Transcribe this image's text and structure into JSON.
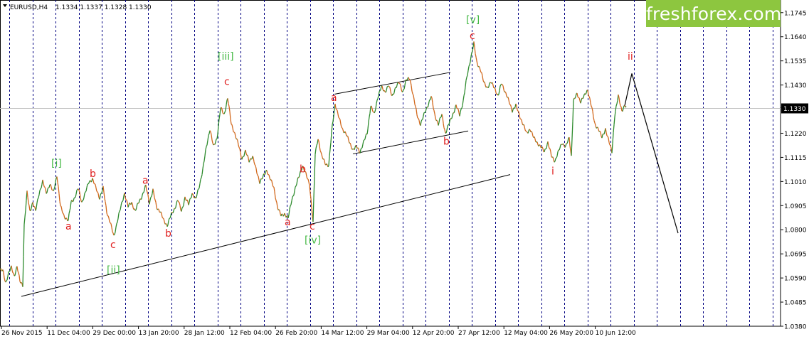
{
  "chart_header": {
    "symbol_label": "EURUSD,H4",
    "ohlc_text": "1.1334 1.1337 1.1328 1.1330",
    "menu_icon": "triangle-down-icon"
  },
  "brand": {
    "logo_text": "freshforex.com",
    "color": "#8dc63f"
  },
  "current_price_label": "1.1330",
  "colors": {
    "bull": "#2e8b2e",
    "bear": "#d2691e",
    "grid": "#000080",
    "wave_red": "#e02020",
    "wave_green": "#46b946",
    "trendline": "#000000"
  },
  "chart_data": {
    "type": "line",
    "y_ticks": [
      "1.1745",
      "1.1640",
      "1.1535",
      "1.1430",
      "1.1330",
      "1.1220",
      "1.1115",
      "1.1010",
      "1.0905",
      "1.0800",
      "1.0695",
      "1.0590",
      "1.0485",
      "1.0380"
    ],
    "x_ticks": [
      "26 Nov 2015",
      "11 Dec 04:00",
      "29 Dec 00:00",
      "13 Jan 20:00",
      "28 Jan 12:00",
      "12 Feb 04:00",
      "26 Feb 20:00",
      "14 Mar 12:00",
      "29 Mar 04:00",
      "12 Apr 20:00",
      "27 Apr 12:00",
      "12 May 04:00",
      "26 May 20:00",
      "10 Jun 12:00"
    ],
    "ylim": [
      1.038,
      1.18
    ],
    "current_price": 1.133,
    "grid": true,
    "price_path": [
      {
        "x": 0,
        "y": 1.0625
      },
      {
        "x": 4,
        "y": 1.062
      },
      {
        "x": 8,
        "y": 1.057
      },
      {
        "x": 12,
        "y": 1.061
      },
      {
        "x": 16,
        "y": 1.0635
      },
      {
        "x": 20,
        "y": 1.06
      },
      {
        "x": 24,
        "y": 1.064
      },
      {
        "x": 28,
        "y": 1.0575
      },
      {
        "x": 32,
        "y": 1.056
      },
      {
        "x": 34,
        "y": 1.082
      },
      {
        "x": 38,
        "y": 1.096
      },
      {
        "x": 42,
        "y": 1.088
      },
      {
        "x": 46,
        "y": 1.092
      },
      {
        "x": 50,
        "y": 1.088
      },
      {
        "x": 55,
        "y": 1.096
      },
      {
        "x": 60,
        "y": 1.101
      },
      {
        "x": 65,
        "y": 1.096
      },
      {
        "x": 70,
        "y": 1.1
      },
      {
        "x": 75,
        "y": 1.096
      },
      {
        "x": 80,
        "y": 1.104
      },
      {
        "x": 85,
        "y": 1.09
      },
      {
        "x": 90,
        "y": 1.086
      },
      {
        "x": 96,
        "y": 1.084
      },
      {
        "x": 100,
        "y": 1.092
      },
      {
        "x": 105,
        "y": 1.094
      },
      {
        "x": 110,
        "y": 1.098
      },
      {
        "x": 115,
        "y": 1.092
      },
      {
        "x": 120,
        "y": 1.096
      },
      {
        "x": 125,
        "y": 1.101
      },
      {
        "x": 130,
        "y": 1.102
      },
      {
        "x": 135,
        "y": 1.098
      },
      {
        "x": 140,
        "y": 1.094
      },
      {
        "x": 145,
        "y": 1.098
      },
      {
        "x": 150,
        "y": 1.088
      },
      {
        "x": 155,
        "y": 1.083
      },
      {
        "x": 160,
        "y": 1.077
      },
      {
        "x": 165,
        "y": 1.084
      },
      {
        "x": 170,
        "y": 1.09
      },
      {
        "x": 175,
        "y": 1.096
      },
      {
        "x": 180,
        "y": 1.09
      },
      {
        "x": 185,
        "y": 1.092
      },
      {
        "x": 190,
        "y": 1.088
      },
      {
        "x": 195,
        "y": 1.092
      },
      {
        "x": 200,
        "y": 1.095
      },
      {
        "x": 205,
        "y": 1.099
      },
      {
        "x": 210,
        "y": 1.092
      },
      {
        "x": 215,
        "y": 1.097
      },
      {
        "x": 220,
        "y": 1.09
      },
      {
        "x": 225,
        "y": 1.088
      },
      {
        "x": 230,
        "y": 1.084
      },
      {
        "x": 235,
        "y": 1.082
      },
      {
        "x": 240,
        "y": 1.086
      },
      {
        "x": 245,
        "y": 1.089
      },
      {
        "x": 250,
        "y": 1.093
      },
      {
        "x": 255,
        "y": 1.088
      },
      {
        "x": 260,
        "y": 1.094
      },
      {
        "x": 265,
        "y": 1.091
      },
      {
        "x": 270,
        "y": 1.096
      },
      {
        "x": 275,
        "y": 1.093
      },
      {
        "x": 280,
        "y": 1.099
      },
      {
        "x": 285,
        "y": 1.106
      },
      {
        "x": 290,
        "y": 1.116
      },
      {
        "x": 295,
        "y": 1.124
      },
      {
        "x": 300,
        "y": 1.116
      },
      {
        "x": 305,
        "y": 1.12
      },
      {
        "x": 310,
        "y": 1.133
      },
      {
        "x": 315,
        "y": 1.13
      },
      {
        "x": 320,
        "y": 1.1375
      },
      {
        "x": 325,
        "y": 1.126
      },
      {
        "x": 330,
        "y": 1.122
      },
      {
        "x": 335,
        "y": 1.117
      },
      {
        "x": 340,
        "y": 1.111
      },
      {
        "x": 345,
        "y": 1.114
      },
      {
        "x": 350,
        "y": 1.11
      },
      {
        "x": 355,
        "y": 1.112
      },
      {
        "x": 360,
        "y": 1.106
      },
      {
        "x": 365,
        "y": 1.101
      },
      {
        "x": 370,
        "y": 1.103
      },
      {
        "x": 375,
        "y": 1.106
      },
      {
        "x": 380,
        "y": 1.102
      },
      {
        "x": 385,
        "y": 1.098
      },
      {
        "x": 390,
        "y": 1.09
      },
      {
        "x": 395,
        "y": 1.086
      },
      {
        "x": 400,
        "y": 1.087
      },
      {
        "x": 405,
        "y": 1.085
      },
      {
        "x": 410,
        "y": 1.093
      },
      {
        "x": 415,
        "y": 1.098
      },
      {
        "x": 420,
        "y": 1.103
      },
      {
        "x": 425,
        "y": 1.108
      },
      {
        "x": 430,
        "y": 1.104
      },
      {
        "x": 435,
        "y": 1.1
      },
      {
        "x": 440,
        "y": 1.083
      },
      {
        "x": 443,
        "y": 1.113
      },
      {
        "x": 447,
        "y": 1.12
      },
      {
        "x": 452,
        "y": 1.112
      },
      {
        "x": 457,
        "y": 1.109
      },
      {
        "x": 462,
        "y": 1.108
      },
      {
        "x": 467,
        "y": 1.125
      },
      {
        "x": 471,
        "y": 1.135
      },
      {
        "x": 476,
        "y": 1.129
      },
      {
        "x": 481,
        "y": 1.124
      },
      {
        "x": 486,
        "y": 1.122
      },
      {
        "x": 491,
        "y": 1.118
      },
      {
        "x": 496,
        "y": 1.115
      },
      {
        "x": 501,
        "y": 1.116
      },
      {
        "x": 506,
        "y": 1.114
      },
      {
        "x": 511,
        "y": 1.118
      },
      {
        "x": 516,
        "y": 1.122
      },
      {
        "x": 521,
        "y": 1.134
      },
      {
        "x": 526,
        "y": 1.13
      },
      {
        "x": 531,
        "y": 1.138
      },
      {
        "x": 536,
        "y": 1.142
      },
      {
        "x": 541,
        "y": 1.14
      },
      {
        "x": 546,
        "y": 1.143
      },
      {
        "x": 551,
        "y": 1.138
      },
      {
        "x": 556,
        "y": 1.142
      },
      {
        "x": 561,
        "y": 1.144
      },
      {
        "x": 566,
        "y": 1.14
      },
      {
        "x": 571,
        "y": 1.145
      },
      {
        "x": 576,
        "y": 1.146
      },
      {
        "x": 581,
        "y": 1.138
      },
      {
        "x": 586,
        "y": 1.13
      },
      {
        "x": 591,
        "y": 1.126
      },
      {
        "x": 596,
        "y": 1.13
      },
      {
        "x": 601,
        "y": 1.134
      },
      {
        "x": 606,
        "y": 1.138
      },
      {
        "x": 611,
        "y": 1.13
      },
      {
        "x": 616,
        "y": 1.126
      },
      {
        "x": 621,
        "y": 1.13
      },
      {
        "x": 626,
        "y": 1.122
      },
      {
        "x": 631,
        "y": 1.126
      },
      {
        "x": 636,
        "y": 1.13
      },
      {
        "x": 641,
        "y": 1.134
      },
      {
        "x": 646,
        "y": 1.13
      },
      {
        "x": 651,
        "y": 1.136
      },
      {
        "x": 656,
        "y": 1.146
      },
      {
        "x": 661,
        "y": 1.154
      },
      {
        "x": 666,
        "y": 1.161
      },
      {
        "x": 670,
        "y": 1.153
      },
      {
        "x": 675,
        "y": 1.15
      },
      {
        "x": 680,
        "y": 1.144
      },
      {
        "x": 685,
        "y": 1.142
      },
      {
        "x": 690,
        "y": 1.144
      },
      {
        "x": 695,
        "y": 1.142
      },
      {
        "x": 700,
        "y": 1.138
      },
      {
        "x": 705,
        "y": 1.144
      },
      {
        "x": 710,
        "y": 1.14
      },
      {
        "x": 715,
        "y": 1.136
      },
      {
        "x": 720,
        "y": 1.132
      },
      {
        "x": 725,
        "y": 1.134
      },
      {
        "x": 730,
        "y": 1.13
      },
      {
        "x": 735,
        "y": 1.126
      },
      {
        "x": 740,
        "y": 1.122
      },
      {
        "x": 745,
        "y": 1.124
      },
      {
        "x": 750,
        "y": 1.12
      },
      {
        "x": 755,
        "y": 1.118
      },
      {
        "x": 760,
        "y": 1.116
      },
      {
        "x": 765,
        "y": 1.114
      },
      {
        "x": 770,
        "y": 1.118
      },
      {
        "x": 775,
        "y": 1.112
      },
      {
        "x": 780,
        "y": 1.11
      },
      {
        "x": 785,
        "y": 1.114
      },
      {
        "x": 790,
        "y": 1.118
      },
      {
        "x": 795,
        "y": 1.116
      },
      {
        "x": 800,
        "y": 1.12
      },
      {
        "x": 803,
        "y": 1.112
      },
      {
        "x": 806,
        "y": 1.136
      },
      {
        "x": 811,
        "y": 1.139
      },
      {
        "x": 816,
        "y": 1.136
      },
      {
        "x": 821,
        "y": 1.138
      },
      {
        "x": 826,
        "y": 1.141
      },
      {
        "x": 831,
        "y": 1.134
      },
      {
        "x": 836,
        "y": 1.126
      },
      {
        "x": 841,
        "y": 1.124
      },
      {
        "x": 846,
        "y": 1.12
      },
      {
        "x": 851,
        "y": 1.124
      },
      {
        "x": 856,
        "y": 1.118
      },
      {
        "x": 860,
        "y": 1.114
      },
      {
        "x": 864,
        "y": 1.13
      },
      {
        "x": 869,
        "y": 1.138
      },
      {
        "x": 874,
        "y": 1.132
      },
      {
        "x": 878,
        "y": 1.134
      },
      {
        "x": 880,
        "y": 1.133
      }
    ],
    "wave_labels": [
      {
        "text": "[i]",
        "color": "green",
        "x": 72,
        "y": 1.1075
      },
      {
        "text": "a",
        "color": "red",
        "x": 92,
        "y": 1.08
      },
      {
        "text": "b",
        "color": "red",
        "x": 126,
        "y": 1.103
      },
      {
        "text": "c",
        "color": "red",
        "x": 155,
        "y": 1.072
      },
      {
        "text": "[ii]",
        "color": "green",
        "x": 150,
        "y": 1.061
      },
      {
        "text": "a",
        "color": "red",
        "x": 200,
        "y": 1.1
      },
      {
        "text": "b",
        "color": "red",
        "x": 232,
        "y": 1.077
      },
      {
        "text": "[iii]",
        "color": "green",
        "x": 306,
        "y": 1.154
      },
      {
        "text": "c",
        "color": "red",
        "x": 315,
        "y": 1.143
      },
      {
        "text": "b",
        "color": "red",
        "x": 421,
        "y": 1.105
      },
      {
        "text": "a",
        "color": "red",
        "x": 400,
        "y": 1.082
      },
      {
        "text": "c",
        "color": "red",
        "x": 435,
        "y": 1.08
      },
      {
        "text": "[iv]",
        "color": "green",
        "x": 428,
        "y": 1.074
      },
      {
        "text": "a",
        "color": "red",
        "x": 465,
        "y": 1.136
      },
      {
        "text": "b",
        "color": "red",
        "x": 623,
        "y": 1.117
      },
      {
        "text": "[v]",
        "color": "green",
        "x": 655,
        "y": 1.17
      },
      {
        "text": "c",
        "color": "red",
        "x": 660,
        "y": 1.163
      },
      {
        "text": "i",
        "color": "red",
        "x": 775,
        "y": 1.104
      },
      {
        "text": "ii",
        "color": "red",
        "x": 882,
        "y": 1.154
      }
    ],
    "trend_lines": [
      {
        "from": {
          "x": 30,
          "y": 1.051
        },
        "to": {
          "x": 717,
          "y": 1.104
        }
      },
      {
        "from": {
          "x": 470,
          "y": 1.139
        },
        "to": {
          "x": 633,
          "y": 1.1485
        }
      },
      {
        "from": {
          "x": 496,
          "y": 1.113
        },
        "to": {
          "x": 658,
          "y": 1.123
        }
      }
    ],
    "forecast_path": [
      {
        "x": 878,
        "y": 1.134
      },
      {
        "x": 888,
        "y": 1.148
      },
      {
        "x": 953,
        "y": 1.0785
      }
    ]
  }
}
